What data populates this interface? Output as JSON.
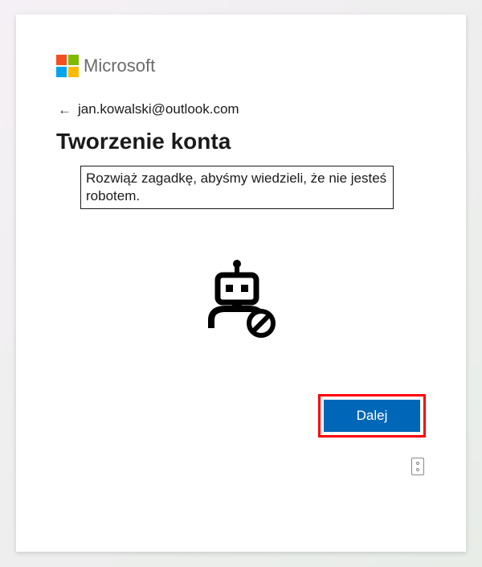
{
  "brand": "Microsoft",
  "email": "jan.kowalski@outlook.com",
  "heading": "Tworzenie konta",
  "instruction": "Rozwiąż zagadkę, abyśmy wiedzieli, że nie jesteś robotem.",
  "primaryButton": "Dalej"
}
